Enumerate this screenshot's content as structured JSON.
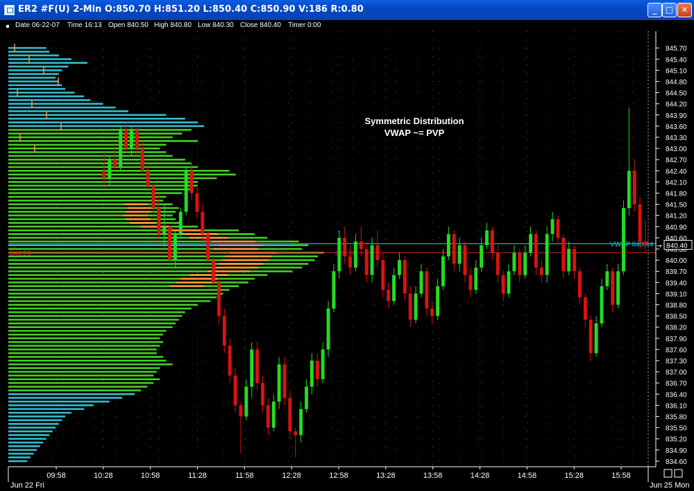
{
  "window": {
    "title": "ER2 #F(U) 2-Min O:850.70 H:851.20 L:850.40 C:850.90 V:186 R:0.80",
    "controls": {
      "minimize": "_",
      "maximize": "□",
      "close": "✕"
    }
  },
  "infobar": {
    "date": "Date 06-22-07",
    "time": "Time 16:13",
    "open": "Open 840.50",
    "high": "High 840.80",
    "low": "Low 840.30",
    "close": "Close 840.40",
    "timer": "Timer 0:00"
  },
  "colors": {
    "background": "#000000",
    "up_candle": "#22dd22",
    "down_candle": "#dd1111",
    "profile_green": "#44cc22",
    "profile_blue": "#33bbcc",
    "profile_value_area": "#ff9933",
    "vwap_line": "#22cccc",
    "pvp_line": "#cc2222",
    "blue_line": "#2233ff",
    "text": "#ffffff"
  },
  "chart_data": {
    "type": "candlestick",
    "title": "",
    "annotation": [
      "Symmetric Distribution",
      "VWAP ~= PVP"
    ],
    "y_tick_labels": [
      "845.70",
      "845.40",
      "845.10",
      "844.80",
      "844.50",
      "844.20",
      "843.90",
      "843.60",
      "843.30",
      "843.00",
      "842.70",
      "842.40",
      "842.10",
      "841.80",
      "841.50",
      "841.20",
      "840.90",
      "840.60",
      "840.30",
      "840.00",
      "839.70",
      "839.40",
      "839.10",
      "838.80",
      "838.50",
      "838.20",
      "837.90",
      "837.60",
      "837.30",
      "837.00",
      "836.70",
      "836.40",
      "836.10",
      "835.80",
      "835.50",
      "835.20",
      "834.90",
      "834.60"
    ],
    "ylim": [
      834.45,
      846.15
    ],
    "x_tick_labels": [
      "09:58",
      "10:28",
      "10:58",
      "11:28",
      "11:58",
      "12:28",
      "12:58",
      "13:28",
      "13:58",
      "14:28",
      "14:58",
      "15:28",
      "15:58"
    ],
    "x_edge_labels": {
      "left": "Jun 22 Fri",
      "right": "Jun 25 Mon"
    },
    "pvp": {
      "price": 840.2,
      "label": "840.20",
      "left_label": "840.20"
    },
    "vwap": {
      "price": 840.44,
      "label": "VWAP 840.44"
    },
    "blue_level": 840.45,
    "last_price": {
      "price": 840.4,
      "label": "840.40"
    },
    "candles_ohlc": [
      [
        842.4,
        842.9,
        841.9,
        842.2
      ],
      [
        842.2,
        842.8,
        842.0,
        842.7
      ],
      [
        842.7,
        843.1,
        842.4,
        842.5
      ],
      [
        842.5,
        843.6,
        842.4,
        843.5
      ],
      [
        843.5,
        843.7,
        842.9,
        843.0
      ],
      [
        843.0,
        843.6,
        842.8,
        843.5
      ],
      [
        843.5,
        843.6,
        842.8,
        843.0
      ],
      [
        843.0,
        843.2,
        842.4,
        842.4
      ],
      [
        842.4,
        842.6,
        841.9,
        842.0
      ],
      [
        842.0,
        842.1,
        841.2,
        841.4
      ],
      [
        841.4,
        841.8,
        840.5,
        840.7
      ],
      [
        840.7,
        841.5,
        840.4,
        840.9
      ],
      [
        840.9,
        840.9,
        839.9,
        840.0
      ],
      [
        840.0,
        840.8,
        839.8,
        840.7
      ],
      [
        840.7,
        841.4,
        840.6,
        841.3
      ],
      [
        841.3,
        842.5,
        841.2,
        842.4
      ],
      [
        842.4,
        842.6,
        841.6,
        841.8
      ],
      [
        841.8,
        842.0,
        841.1,
        841.3
      ],
      [
        841.3,
        841.5,
        840.5,
        840.7
      ],
      [
        840.7,
        840.8,
        839.9,
        840.0
      ],
      [
        840.0,
        840.2,
        839.2,
        839.4
      ],
      [
        839.4,
        839.5,
        838.3,
        838.5
      ],
      [
        838.5,
        838.7,
        837.5,
        837.7
      ],
      [
        837.7,
        837.9,
        836.7,
        836.9
      ],
      [
        836.9,
        837.1,
        835.9,
        836.1
      ],
      [
        836.1,
        836.2,
        834.8,
        835.8
      ],
      [
        835.8,
        836.8,
        835.7,
        836.6
      ],
      [
        836.6,
        837.8,
        836.3,
        837.6
      ],
      [
        837.6,
        837.8,
        836.5,
        836.7
      ],
      [
        836.7,
        836.9,
        835.9,
        836.1
      ],
      [
        836.1,
        836.3,
        835.3,
        835.5
      ],
      [
        835.5,
        836.4,
        835.4,
        836.2
      ],
      [
        836.2,
        837.4,
        836.0,
        837.2
      ],
      [
        837.2,
        837.4,
        836.1,
        836.3
      ],
      [
        836.3,
        836.5,
        835.2,
        835.4
      ],
      [
        835.4,
        835.5,
        834.7,
        835.3
      ],
      [
        835.3,
        836.2,
        835.1,
        836.0
      ],
      [
        836.0,
        836.8,
        835.9,
        836.6
      ],
      [
        836.6,
        837.5,
        836.4,
        837.3
      ],
      [
        837.3,
        837.5,
        836.6,
        836.8
      ],
      [
        836.8,
        837.8,
        836.7,
        837.6
      ],
      [
        837.6,
        838.9,
        837.4,
        838.7
      ],
      [
        838.7,
        839.9,
        838.6,
        839.7
      ],
      [
        839.7,
        840.8,
        839.5,
        840.6
      ],
      [
        840.6,
        840.9,
        839.9,
        840.1
      ],
      [
        840.1,
        840.4,
        839.6,
        839.8
      ],
      [
        839.8,
        840.7,
        839.7,
        840.5
      ],
      [
        840.5,
        840.9,
        840.1,
        840.3
      ],
      [
        840.3,
        840.5,
        839.4,
        839.6
      ],
      [
        839.6,
        840.6,
        839.4,
        840.4
      ],
      [
        840.4,
        840.8,
        839.8,
        840.0
      ],
      [
        840.0,
        840.2,
        839.0,
        839.2
      ],
      [
        839.2,
        839.4,
        838.7,
        838.9
      ],
      [
        838.9,
        839.8,
        838.8,
        839.6
      ],
      [
        839.6,
        840.2,
        839.5,
        840.0
      ],
      [
        840.0,
        840.1,
        838.9,
        839.1
      ],
      [
        839.1,
        839.3,
        838.2,
        838.4
      ],
      [
        838.4,
        839.3,
        838.3,
        839.1
      ],
      [
        839.1,
        839.9,
        839.0,
        839.7
      ],
      [
        839.7,
        839.8,
        838.5,
        838.7
      ],
      [
        838.7,
        838.9,
        838.3,
        838.5
      ],
      [
        838.5,
        839.5,
        838.4,
        839.3
      ],
      [
        839.3,
        840.3,
        839.2,
        840.1
      ],
      [
        840.1,
        840.9,
        840.0,
        840.7
      ],
      [
        840.7,
        840.8,
        839.7,
        839.9
      ],
      [
        839.9,
        840.6,
        839.7,
        840.4
      ],
      [
        840.4,
        840.5,
        839.4,
        839.6
      ],
      [
        839.6,
        839.8,
        839.0,
        839.2
      ],
      [
        839.2,
        840.0,
        839.1,
        839.8
      ],
      [
        839.8,
        840.6,
        839.7,
        840.4
      ],
      [
        840.4,
        841.0,
        840.3,
        840.8
      ],
      [
        840.8,
        840.9,
        840.0,
        840.2
      ],
      [
        840.2,
        840.4,
        839.4,
        839.6
      ],
      [
        839.6,
        839.7,
        838.9,
        839.1
      ],
      [
        839.1,
        839.9,
        839.0,
        839.7
      ],
      [
        839.7,
        840.4,
        839.6,
        840.2
      ],
      [
        840.2,
        840.3,
        839.4,
        839.6
      ],
      [
        839.6,
        840.4,
        839.5,
        840.2
      ],
      [
        840.2,
        840.9,
        840.1,
        840.7
      ],
      [
        840.7,
        840.8,
        839.6,
        839.8
      ],
      [
        839.8,
        840.0,
        839.4,
        839.6
      ],
      [
        839.6,
        840.9,
        839.4,
        840.7
      ],
      [
        840.7,
        841.3,
        840.5,
        841.1
      ],
      [
        841.1,
        841.2,
        840.4,
        840.6
      ],
      [
        840.6,
        840.7,
        839.5,
        839.7
      ],
      [
        839.7,
        840.5,
        839.6,
        840.3
      ],
      [
        840.3,
        840.4,
        839.5,
        839.7
      ],
      [
        839.7,
        839.8,
        838.8,
        839.0
      ],
      [
        839.0,
        839.1,
        838.2,
        838.4
      ],
      [
        838.4,
        838.5,
        837.3,
        837.5
      ],
      [
        837.5,
        838.5,
        837.4,
        838.3
      ],
      [
        838.3,
        839.5,
        838.2,
        839.3
      ],
      [
        839.3,
        839.9,
        839.2,
        839.7
      ],
      [
        839.7,
        839.8,
        838.6,
        838.8
      ],
      [
        838.8,
        839.9,
        838.7,
        839.7
      ],
      [
        839.7,
        841.6,
        839.6,
        841.4
      ],
      [
        841.4,
        844.1,
        841.2,
        842.4
      ],
      [
        842.4,
        842.7,
        841.3,
        841.5
      ],
      [
        841.5,
        841.7,
        840.3,
        840.5
      ],
      [
        840.5,
        841.1,
        840.2,
        840.4
      ]
    ],
    "volume_profile": [
      [
        845.7,
        0.12
      ],
      [
        845.6,
        0.13
      ],
      [
        845.5,
        0.16
      ],
      [
        845.4,
        0.2
      ],
      [
        845.3,
        0.25
      ],
      [
        845.2,
        0.19
      ],
      [
        845.1,
        0.17
      ],
      [
        845.0,
        0.16
      ],
      [
        844.9,
        0.15
      ],
      [
        844.8,
        0.16
      ],
      [
        844.7,
        0.17
      ],
      [
        844.6,
        0.18
      ],
      [
        844.5,
        0.21
      ],
      [
        844.4,
        0.24
      ],
      [
        844.3,
        0.26
      ],
      [
        844.2,
        0.3
      ],
      [
        844.1,
        0.34
      ],
      [
        844.0,
        0.38
      ],
      [
        843.9,
        0.5
      ],
      [
        843.8,
        0.56
      ],
      [
        843.7,
        0.6
      ],
      [
        843.6,
        0.62
      ],
      [
        843.5,
        0.58
      ],
      [
        843.4,
        0.55
      ],
      [
        843.3,
        0.52
      ],
      [
        843.2,
        0.6
      ],
      [
        843.1,
        0.5
      ],
      [
        843.0,
        0.48
      ],
      [
        842.9,
        0.5
      ],
      [
        842.8,
        0.52
      ],
      [
        842.7,
        0.56
      ],
      [
        842.6,
        0.58
      ],
      [
        842.5,
        0.6
      ],
      [
        842.4,
        0.7
      ],
      [
        842.3,
        0.72
      ],
      [
        842.2,
        0.66
      ],
      [
        842.1,
        0.6
      ],
      [
        842.0,
        0.6
      ],
      [
        841.9,
        0.58
      ],
      [
        841.8,
        0.55
      ],
      [
        841.7,
        0.5
      ],
      [
        841.6,
        0.49
      ],
      [
        841.5,
        0.52
      ],
      [
        841.4,
        0.54
      ],
      [
        841.3,
        0.53
      ],
      [
        841.2,
        0.52
      ],
      [
        841.1,
        0.53
      ],
      [
        841.0,
        0.55
      ],
      [
        840.9,
        0.6
      ],
      [
        840.8,
        0.73
      ],
      [
        840.7,
        0.78
      ],
      [
        840.6,
        0.82
      ],
      [
        840.5,
        0.92
      ],
      [
        840.4,
        0.95
      ],
      [
        840.3,
        0.93
      ],
      [
        840.2,
        1.0
      ],
      [
        840.1,
        0.98
      ],
      [
        840.0,
        0.97
      ],
      [
        839.9,
        0.95
      ],
      [
        839.8,
        0.93
      ],
      [
        839.7,
        0.9
      ],
      [
        839.6,
        0.82
      ],
      [
        839.5,
        0.78
      ],
      [
        839.4,
        0.76
      ],
      [
        839.3,
        0.73
      ],
      [
        839.2,
        0.7
      ],
      [
        839.1,
        0.68
      ],
      [
        839.0,
        0.66
      ],
      [
        838.9,
        0.64
      ],
      [
        838.8,
        0.6
      ],
      [
        838.7,
        0.58
      ],
      [
        838.6,
        0.56
      ],
      [
        838.5,
        0.55
      ],
      [
        838.4,
        0.54
      ],
      [
        838.3,
        0.53
      ],
      [
        838.2,
        0.52
      ],
      [
        838.1,
        0.5
      ],
      [
        838.0,
        0.49
      ],
      [
        837.9,
        0.48
      ],
      [
        837.8,
        0.49
      ],
      [
        837.7,
        0.48
      ],
      [
        837.6,
        0.47
      ],
      [
        837.5,
        0.47
      ],
      [
        837.4,
        0.49
      ],
      [
        837.3,
        0.5
      ],
      [
        837.2,
        0.52
      ],
      [
        837.1,
        0.48
      ],
      [
        837.0,
        0.47
      ],
      [
        836.9,
        0.46
      ],
      [
        836.8,
        0.48
      ],
      [
        836.7,
        0.46
      ],
      [
        836.6,
        0.44
      ],
      [
        836.5,
        0.42
      ],
      [
        836.4,
        0.4
      ],
      [
        836.3,
        0.36
      ],
      [
        836.2,
        0.32
      ],
      [
        836.1,
        0.27
      ],
      [
        836.0,
        0.24
      ],
      [
        835.9,
        0.2
      ],
      [
        835.8,
        0.18
      ],
      [
        835.7,
        0.17
      ],
      [
        835.6,
        0.16
      ],
      [
        835.5,
        0.15
      ],
      [
        835.4,
        0.14
      ],
      [
        835.3,
        0.13
      ],
      [
        835.2,
        0.12
      ],
      [
        835.1,
        0.11
      ],
      [
        835.0,
        0.1
      ],
      [
        834.9,
        0.09
      ],
      [
        834.8,
        0.08
      ],
      [
        834.7,
        0.07
      ],
      [
        834.6,
        0.06
      ]
    ],
    "value_area": [
      839.3,
      841.6
    ]
  }
}
